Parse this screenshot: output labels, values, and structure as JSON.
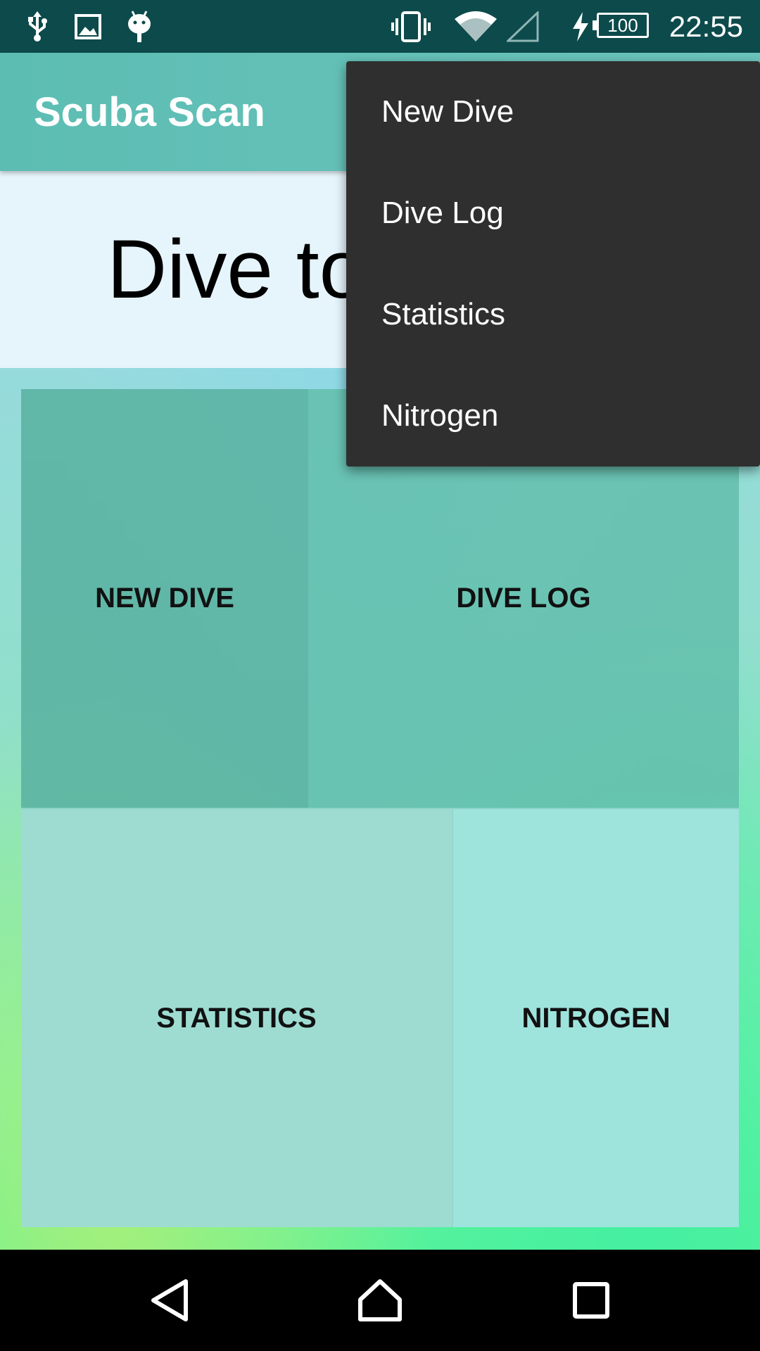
{
  "status_bar": {
    "time": "22:55",
    "battery_level": "100",
    "icons": [
      "usb-icon",
      "image-icon",
      "android-icon",
      "vibrate-icon",
      "wifi-icon",
      "signal-icon",
      "charging-icon",
      "battery-icon"
    ]
  },
  "app_bar": {
    "title": "Scuba Scan",
    "color": "#5cbdb3"
  },
  "main": {
    "welcome_text": "Dive to",
    "tiles": [
      {
        "label": "NEW DIVE"
      },
      {
        "label": "DIVE LOG"
      },
      {
        "label": "STATISTICS"
      },
      {
        "label": "NITROGEN"
      }
    ]
  },
  "overflow_menu": {
    "items": [
      {
        "label": "New Dive"
      },
      {
        "label": "Dive Log"
      },
      {
        "label": "Statistics"
      },
      {
        "label": "Nitrogen"
      }
    ],
    "background": "#2f2f2f"
  },
  "nav_bar": {
    "buttons": [
      "back-icon",
      "home-icon",
      "recents-icon"
    ]
  }
}
